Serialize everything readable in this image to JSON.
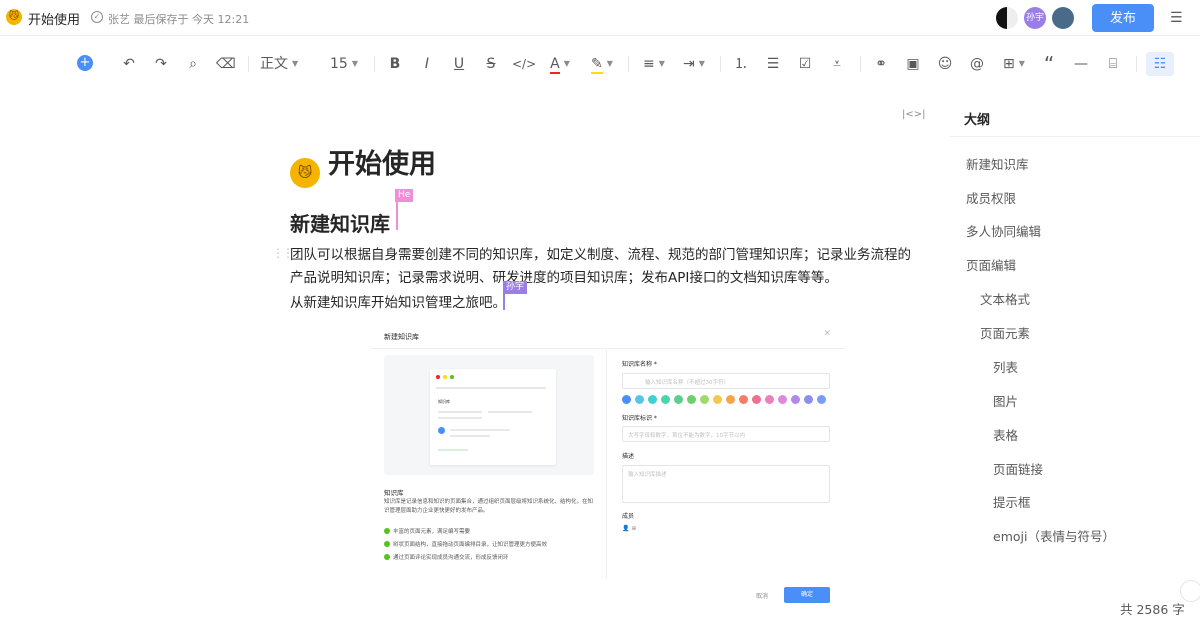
{
  "header": {
    "title": "开始使用",
    "doc_emoji": "😼",
    "save_status": "张艺 最后保存于 今天 12:21",
    "collaborator_2": "孙宇",
    "publish_label": "发布"
  },
  "toolbar": {
    "style_label": "正文",
    "font_size": "15"
  },
  "document": {
    "title": "开始使用",
    "title_emoji": "😼",
    "heading": "新建知识库",
    "paragraph": "团队可以根据自身需要创建不同的知识库，如定义制度、流程、规范的部门管理知识库；记录业务流程的产品说明知识库；记录需求说明、研发进度的项目知识库；发布API接口的文档知识库等等。",
    "paragraph2": "从新建知识库开始知识管理之旅吧。",
    "cursors": [
      {
        "name": "He",
        "color": "#f08fd8"
      },
      {
        "name": "孙宇",
        "color": "#9a7de6"
      }
    ]
  },
  "embed": {
    "dialog_title": "新建知识库",
    "preview_card_title": "知识库",
    "left_title": "知识库",
    "left_desc": "知识库是记录信息和知识的页面集合，通过组织页面层级将知识系统化、结构化，在知识管理层面助力企业更快更好的发布产品。",
    "features": [
      "丰富的页面元素，满足编写需要",
      "树状页面结构，直接拖动页面编排目录，让知识管理更方便高效",
      "通过页面评论实现成员沟通交流，形成反馈闭环"
    ],
    "name_label": "知识库名称 *",
    "name_placeholder": "输入知识库名称（不超过30字符）",
    "id_label": "知识库标识 *",
    "id_placeholder": "大写字母和数字，首位不能为数字，10字节以内",
    "desc_label": "描述",
    "desc_placeholder": "输入知识库描述",
    "members_label": "成员",
    "cancel": "取消",
    "ok": "确定",
    "swatch_colors": [
      "#4a8ff7",
      "#56c6e8",
      "#3fd0d0",
      "#4dd4a8",
      "#5ccf8a",
      "#6fcf6f",
      "#a5d86a",
      "#f2c94c",
      "#f5a64a",
      "#f47c6a",
      "#f06f8e",
      "#ef7fb7",
      "#d98be0",
      "#b08ae8",
      "#8e8ef0",
      "#7b9cf5"
    ]
  },
  "outline": {
    "title": "大纲",
    "items": [
      {
        "label": "新建知识库",
        "level": 1
      },
      {
        "label": "成员权限",
        "level": 1
      },
      {
        "label": "多人协同编辑",
        "level": 1
      },
      {
        "label": "页面编辑",
        "level": 1
      },
      {
        "label": "文本格式",
        "level": 2
      },
      {
        "label": "页面元素",
        "level": 2
      },
      {
        "label": "列表",
        "level": 3
      },
      {
        "label": "图片",
        "level": 3
      },
      {
        "label": "表格",
        "level": 3
      },
      {
        "label": "页面链接",
        "level": 3
      },
      {
        "label": "提示框",
        "level": 3
      },
      {
        "label": "emoji（表情与符号）",
        "level": 3
      }
    ]
  },
  "footer": {
    "word_count": "共 2586 字"
  },
  "colors": {
    "accent": "#4a8ff7"
  }
}
